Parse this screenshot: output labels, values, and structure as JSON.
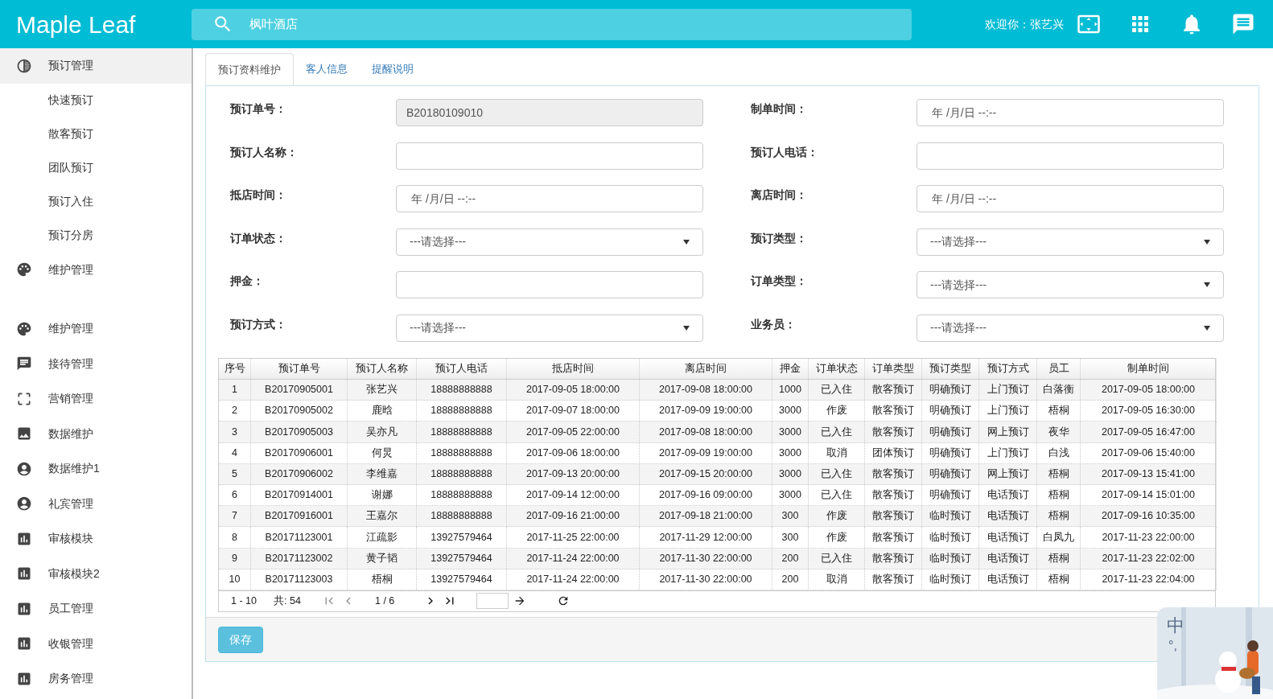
{
  "header": {
    "logo": "Maple Leaf",
    "search_value": "枫叶酒店",
    "welcome": "欢迎你：张艺兴"
  },
  "sidebar": {
    "items": [
      {
        "label": "预订管理",
        "selected": true,
        "children": [
          {
            "label": "快速预订"
          },
          {
            "label": "散客预订"
          },
          {
            "label": "团队预订"
          },
          {
            "label": "预订入住"
          },
          {
            "label": "预订分房"
          }
        ]
      },
      {
        "label": "维护管理",
        "selected": false
      },
      {
        "label": "维护管理",
        "selected": false
      },
      {
        "label": "接待管理",
        "selected": false
      },
      {
        "label": "营销管理",
        "selected": false
      },
      {
        "label": "数据维护",
        "selected": false
      },
      {
        "label": "数据维护1",
        "selected": false
      },
      {
        "label": "礼宾管理",
        "selected": false
      },
      {
        "label": "审核模块",
        "selected": false
      },
      {
        "label": "审核模块2",
        "selected": false
      },
      {
        "label": "员工管理",
        "selected": false
      },
      {
        "label": "收银管理",
        "selected": false
      },
      {
        "label": "房务管理",
        "selected": false
      }
    ]
  },
  "tabs": [
    {
      "label": "预订资料维护",
      "selected": true
    },
    {
      "label": "客人信息",
      "selected": false
    },
    {
      "label": "提醒说明",
      "selected": false
    }
  ],
  "form": {
    "fields": [
      {
        "label": "预订单号：",
        "kind": "text",
        "value": "B20180109010",
        "disabled": true
      },
      {
        "label": "制单时间：",
        "kind": "datetime",
        "value": "年 /月/日 --:--",
        "disabled": false
      },
      {
        "label": "预订人名称：",
        "kind": "text",
        "disabled": false
      },
      {
        "label": "预订人电话：",
        "kind": "text",
        "disabled": false
      },
      {
        "label": "抵店时间：",
        "kind": "datetime",
        "value": "年 /月/日 --:--",
        "disabled": false
      },
      {
        "label": "离店时间：",
        "kind": "datetime",
        "value": "年 /月/日 --:--",
        "disabled": false
      },
      {
        "label": "订单状态：",
        "kind": "select",
        "value": "---请选择---",
        "disabled": false
      },
      {
        "label": "预订类型：",
        "kind": "select",
        "value": "---请选择---",
        "disabled": false
      },
      {
        "label": "押金：",
        "kind": "text",
        "disabled": false
      },
      {
        "label": "订单类型：",
        "kind": "select",
        "value": "---请选择---",
        "disabled": false
      },
      {
        "label": "预订方式：",
        "kind": "select",
        "value": "---请选择---",
        "disabled": false
      },
      {
        "label": "业务员：",
        "kind": "select",
        "value": "---请选择---",
        "disabled": false
      }
    ]
  },
  "table": {
    "columns": [
      "序号",
      "预订单号",
      "预订人名称",
      "预订人电话",
      "抵店时间",
      "离店时间",
      "押金",
      "订单状态",
      "订单类型",
      "预订类型",
      "预订方式",
      "员工",
      "制单时间"
    ],
    "rows": [
      [
        "1",
        "B20170905001",
        "张艺兴",
        "18888888888",
        "2017-09-05 18:00:00",
        "2017-09-08 18:00:00",
        "1000",
        "已入住",
        "散客预订",
        "明确预订",
        "上门预订",
        "白落衡",
        "2017-09-05 18:00:00"
      ],
      [
        "2",
        "B20170905002",
        "鹿晗",
        "18888888888",
        "2017-09-07 18:00:00",
        "2017-09-09 19:00:00",
        "3000",
        "作废",
        "散客预订",
        "明确预订",
        "上门预订",
        "梧桐",
        "2017-09-05 16:30:00"
      ],
      [
        "3",
        "B20170905003",
        "吴亦凡",
        "18888888888",
        "2017-09-05 22:00:00",
        "2017-09-08 18:00:00",
        "3000",
        "已入住",
        "散客预订",
        "明确预订",
        "网上预订",
        "夜华",
        "2017-09-05 16:47:00"
      ],
      [
        "4",
        "B20170906001",
        "何炅",
        "18888888888",
        "2017-09-06 18:00:00",
        "2017-09-09 19:00:00",
        "3000",
        "取消",
        "团体预订",
        "明确预订",
        "上门预订",
        "白浅",
        "2017-09-06 15:40:00"
      ],
      [
        "5",
        "B20170906002",
        "李维嘉",
        "18888888888",
        "2017-09-13 20:00:00",
        "2017-09-15 20:00:00",
        "3000",
        "已入住",
        "散客预订",
        "明确预订",
        "网上预订",
        "梧桐",
        "2017-09-13 15:41:00"
      ],
      [
        "6",
        "B20170914001",
        "谢娜",
        "18888888888",
        "2017-09-14 12:00:00",
        "2017-09-16 09:00:00",
        "3000",
        "已入住",
        "散客预订",
        "明确预订",
        "电话预订",
        "梧桐",
        "2017-09-14 15:01:00"
      ],
      [
        "7",
        "B20170916001",
        "王嘉尔",
        "18888888888",
        "2017-09-16 21:00:00",
        "2017-09-18 21:00:00",
        "300",
        "作废",
        "散客预订",
        "临时预订",
        "电话预订",
        "梧桐",
        "2017-09-16 10:35:00"
      ],
      [
        "8",
        "B20171123001",
        "江疏影",
        "13927579464",
        "2017-11-25 22:00:00",
        "2017-11-29 12:00:00",
        "300",
        "作废",
        "散客预订",
        "临时预订",
        "电话预订",
        "白凤九",
        "2017-11-23 22:00:00"
      ],
      [
        "9",
        "B20171123002",
        "黄子韬",
        "13927579464",
        "2017-11-24 22:00:00",
        "2017-11-30 22:00:00",
        "200",
        "已入住",
        "散客预订",
        "临时预订",
        "电话预订",
        "梧桐",
        "2017-11-23 22:02:00"
      ],
      [
        "10",
        "B20171123003",
        "梧桐",
        "13927579464",
        "2017-11-24 22:00:00",
        "2017-11-30 22:00:00",
        "200",
        "取消",
        "散客预订",
        "临时预订",
        "电话预订",
        "梧桐",
        "2017-11-23 22:04:00"
      ]
    ]
  },
  "pagination": {
    "range": "1 - 10",
    "total": "共: 54",
    "page": "1 / 6"
  },
  "save_button": "保存",
  "ime_widget": {
    "mode": "中",
    "punctuation": "°,"
  }
}
